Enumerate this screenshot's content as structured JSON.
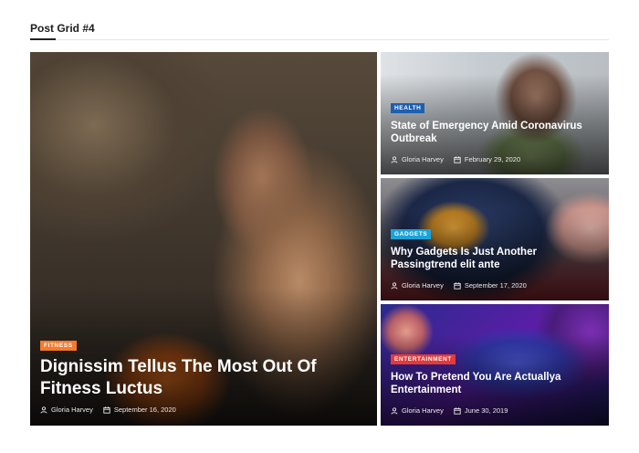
{
  "section": {
    "title": "Post Grid #4"
  },
  "posts": [
    {
      "category": "FITNESS",
      "category_color": "#f47a2c",
      "title": "Dignissim Tellus The Most Out Of Fitness Luctus",
      "author": "Gloria Harvey",
      "date": "September 16, 2020"
    },
    {
      "category": "HEALTH",
      "category_color": "#1f5fb0",
      "title": "State of Emergency Amid Coronavirus Outbreak",
      "author": "Gloria Harvey",
      "date": "February 29, 2020"
    },
    {
      "category": "GADGETS",
      "category_color": "#1aa3d9",
      "title": "Why Gadgets Is Just Another Passingtrend elit ante",
      "author": "Gloria Harvey",
      "date": "September 17, 2020"
    },
    {
      "category": "ENTERTAINMENT",
      "category_color": "#e23b3b",
      "title": "How To Pretend You Are Actuallya Entertainment",
      "author": "Gloria Harvey",
      "date": "June 30, 2019"
    }
  ],
  "icons": {
    "author": "user-icon",
    "date": "calendar-icon"
  }
}
